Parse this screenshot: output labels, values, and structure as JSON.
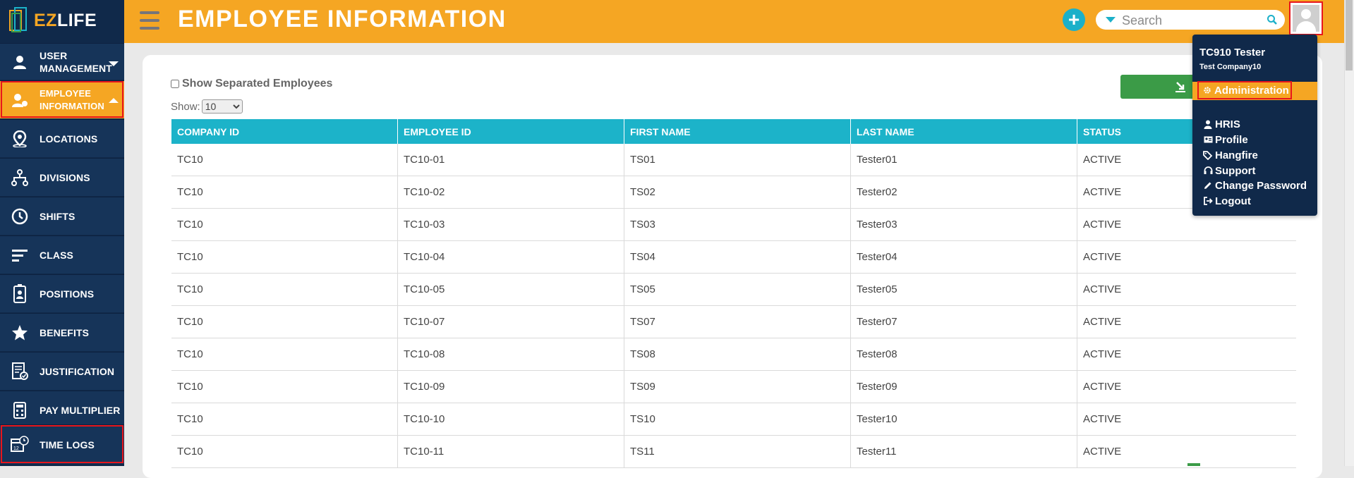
{
  "app": {
    "logo_ez": "EZ",
    "logo_life": "LIFE",
    "page_title": "EMPLOYEE INFORMATION"
  },
  "sidebar": {
    "items": [
      {
        "label": "USER MANAGEMENT",
        "icon": "user-icon"
      },
      {
        "label": "EMPLOYEE INFORMATION",
        "icon": "employee-icon"
      },
      {
        "label": "LOCATIONS",
        "icon": "location-pin-icon"
      },
      {
        "label": "DIVISIONS",
        "icon": "hierarchy-icon"
      },
      {
        "label": "SHIFTS",
        "icon": "clock-icon"
      },
      {
        "label": "CLASS",
        "icon": "lines-icon"
      },
      {
        "label": "POSITIONS",
        "icon": "id-badge-icon"
      },
      {
        "label": "BENEFITS",
        "icon": "star-icon"
      },
      {
        "label": "JUSTIFICATION",
        "icon": "document-check-icon"
      },
      {
        "label": "PAY MULTIPLIER",
        "icon": "calculator-icon"
      },
      {
        "label": "TIME LOGS",
        "icon": "calendar-clock-icon"
      }
    ]
  },
  "header": {
    "search_placeholder": "Search"
  },
  "filters": {
    "show_separated_label": "Show Separated Employees",
    "show_label": "Show:",
    "page_size": "10",
    "page_size_options": [
      "10"
    ]
  },
  "table": {
    "headers": [
      "COMPANY ID",
      "EMPLOYEE ID",
      "FIRST NAME",
      "LAST NAME",
      "STATUS"
    ],
    "rows": [
      [
        "TC10",
        "TC10-01",
        "TS01",
        "Tester01",
        "ACTIVE"
      ],
      [
        "TC10",
        "TC10-02",
        "TS02",
        "Tester02",
        "ACTIVE"
      ],
      [
        "TC10",
        "TC10-03",
        "TS03",
        "Tester03",
        "ACTIVE"
      ],
      [
        "TC10",
        "TC10-04",
        "TS04",
        "Tester04",
        "ACTIVE"
      ],
      [
        "TC10",
        "TC10-05",
        "TS05",
        "Tester05",
        "ACTIVE"
      ],
      [
        "TC10",
        "TC10-07",
        "TS07",
        "Tester07",
        "ACTIVE"
      ],
      [
        "TC10",
        "TC10-08",
        "TS08",
        "Tester08",
        "ACTIVE"
      ],
      [
        "TC10",
        "TC10-09",
        "TS09",
        "Tester09",
        "ACTIVE"
      ],
      [
        "TC10",
        "TC10-10",
        "TS10",
        "Tester10",
        "ACTIVE"
      ],
      [
        "TC10",
        "TC10-11",
        "TS11",
        "Tester11",
        "ACTIVE"
      ]
    ]
  },
  "user_menu": {
    "user_name": "TC910 Tester",
    "company": "Test Company10",
    "items": [
      {
        "label": "Administration",
        "icon": "gear-icon"
      },
      {
        "label": "HRIS",
        "icon": "person-icon"
      },
      {
        "label": "Profile",
        "icon": "id-card-icon"
      },
      {
        "label": "Hangfire",
        "icon": "tags-icon"
      },
      {
        "label": "Support",
        "icon": "headset-icon"
      },
      {
        "label": "Change Password",
        "icon": "pencil-icon"
      },
      {
        "label": "Logout",
        "icon": "sign-out-icon"
      }
    ]
  },
  "colors": {
    "header": "#f5a623",
    "sidebar": "#10294a",
    "sidebar_item": "#163459",
    "table_header": "#1cb3c9",
    "accent_green": "#3b9b47",
    "highlight_red": "#e8161c"
  }
}
